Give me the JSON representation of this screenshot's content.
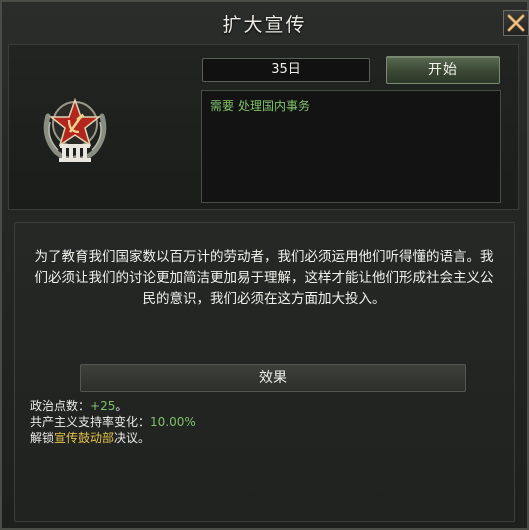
{
  "window": {
    "title": "扩大宣传"
  },
  "decision": {
    "days": "35日",
    "start_label": "开始",
    "requirement_label": "需要",
    "requirement_value": "处理国内事务",
    "description": "为了教育我们国家数以百万计的劳动者，我们必须运用他们听得懂的语言。我们必须让我们的讨论更加简洁更加易于理解，这样才能让他们形成社会主义公民的意识，我们必须在这方面加大投入。"
  },
  "effects": {
    "header": "效果",
    "political_power_label": "政治点数：",
    "political_power_value": "+25",
    "political_power_suffix": "。",
    "support_label": "共产主义支持率变化：",
    "support_value": "10.00%",
    "unlock_prefix": "解锁",
    "unlock_target": "宣传鼓动部",
    "unlock_suffix": "决议。"
  },
  "icons": {
    "close": "close-x-icon",
    "emblem": "communist-star-emblem-icon"
  },
  "colors": {
    "positive_green": "#7fc26a",
    "highlight_yellow": "#e3c34a"
  }
}
